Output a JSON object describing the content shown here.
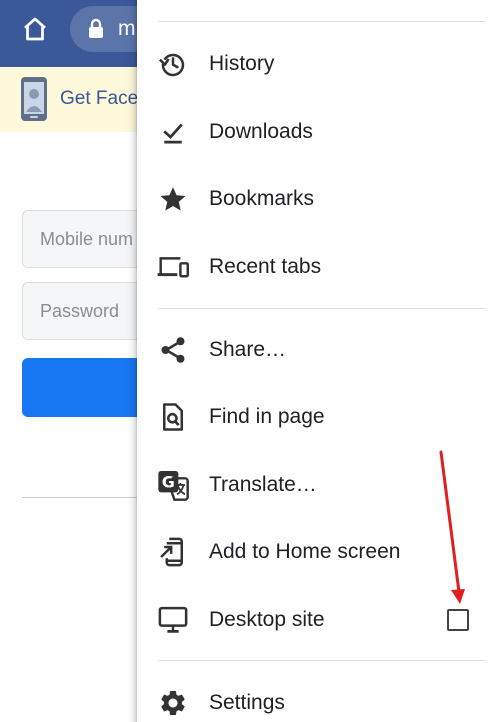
{
  "toolbar": {
    "url_text": "m"
  },
  "banner": {
    "text": "Get Face"
  },
  "login": {
    "mobile_placeholder": "Mobile num",
    "password_placeholder": "Password"
  },
  "menu": {
    "items": [
      {
        "label": "History",
        "icon": "history-icon"
      },
      {
        "label": "Downloads",
        "icon": "download-icon"
      },
      {
        "label": "Bookmarks",
        "icon": "star-icon"
      },
      {
        "label": "Recent tabs",
        "icon": "devices-icon"
      },
      {
        "label": "Share…",
        "icon": "share-icon"
      },
      {
        "label": "Find in page",
        "icon": "find-in-page-icon"
      },
      {
        "label": "Translate…",
        "icon": "translate-icon"
      },
      {
        "label": "Add to Home screen",
        "icon": "add-to-home-icon"
      },
      {
        "label": "Desktop site",
        "icon": "desktop-icon",
        "checked": false
      },
      {
        "label": "Settings",
        "icon": "gear-icon"
      }
    ]
  },
  "colors": {
    "toolbar": "#3b5998",
    "banner": "#fff9db",
    "login_button": "#1877f2",
    "annotation_arrow": "#e02020"
  }
}
